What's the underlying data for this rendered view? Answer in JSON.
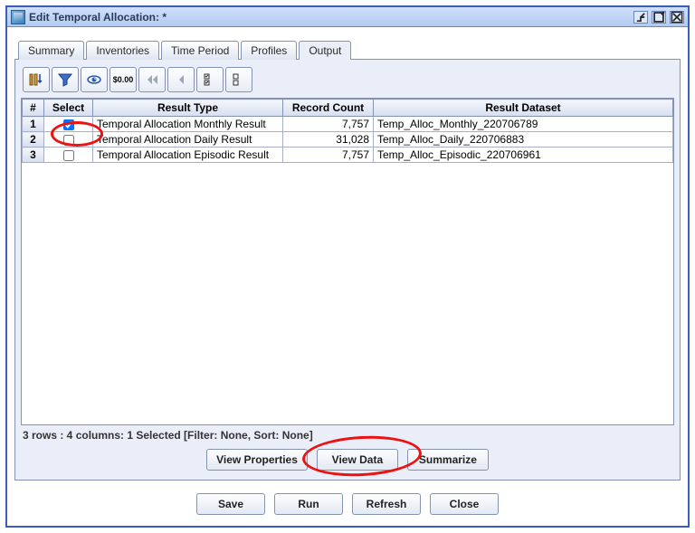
{
  "window": {
    "title": "Edit Temporal Allocation: *"
  },
  "tabs": [
    {
      "label": "Summary"
    },
    {
      "label": "Inventories"
    },
    {
      "label": "Time Period"
    },
    {
      "label": "Profiles"
    },
    {
      "label": "Output"
    }
  ],
  "active_tab": "Output",
  "toolbar_icons": [
    "sort-columns-icon",
    "filter-icon",
    "show-hide-icon",
    "format-icon",
    "first-icon",
    "prev-icon",
    "select-all-icon",
    "clear-selection-icon"
  ],
  "table": {
    "headers": {
      "row_num": "#",
      "select": "Select",
      "result_type": "Result Type",
      "record_count": "Record Count",
      "result_dataset": "Result Dataset"
    },
    "rows": [
      {
        "n": "1",
        "selected": true,
        "result_type": "Temporal Allocation Monthly Result",
        "record_count": "7,757",
        "result_dataset": "Temp_Alloc_Monthly_220706789"
      },
      {
        "n": "2",
        "selected": false,
        "result_type": "Temporal Allocation Daily Result",
        "record_count": "31,028",
        "result_dataset": "Temp_Alloc_Daily_220706883"
      },
      {
        "n": "3",
        "selected": false,
        "result_type": "Temporal Allocation Episodic Result",
        "record_count": "7,757",
        "result_dataset": "Temp_Alloc_Episodic_220706961"
      }
    ]
  },
  "status": "3 rows : 4 columns: 1 Selected [Filter: None, Sort: None]",
  "output_buttons": {
    "view_properties": "View Properties",
    "view_data": "View Data",
    "summarize": "Summarize"
  },
  "dialog_buttons": {
    "save": "Save",
    "run": "Run",
    "refresh": "Refresh",
    "close": "Close"
  }
}
